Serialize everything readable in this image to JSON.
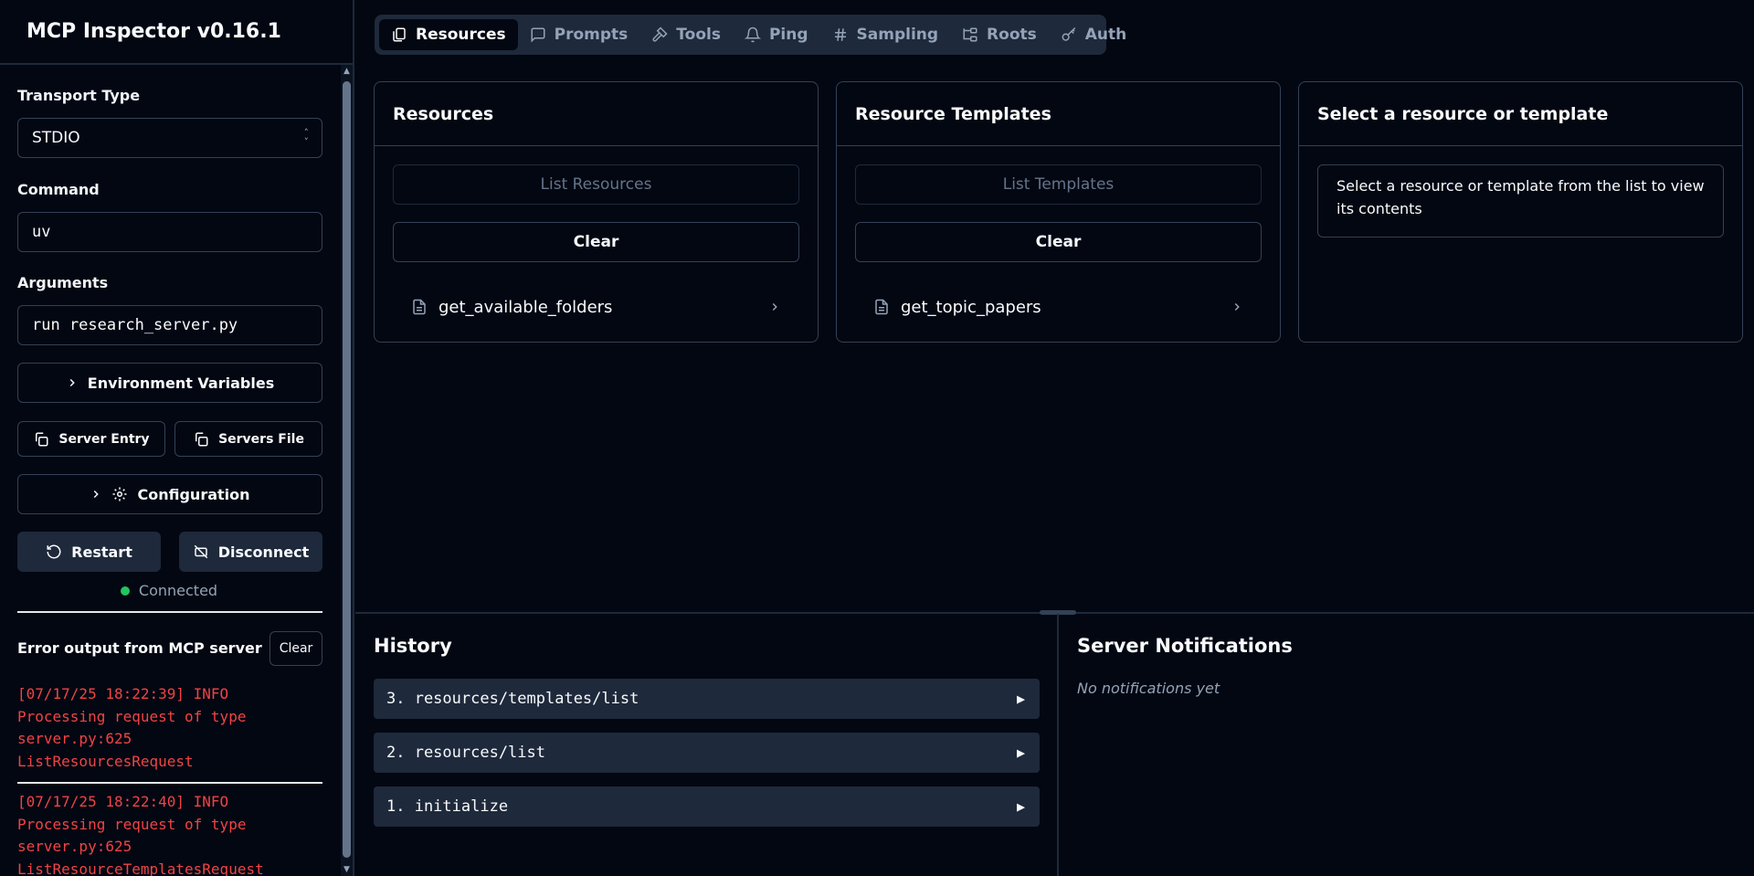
{
  "app": {
    "title": "MCP Inspector v0.16.1"
  },
  "sidebar": {
    "transport_label": "Transport Type",
    "transport_value": "STDIO",
    "command_label": "Command",
    "command_value": "uv",
    "arguments_label": "Arguments",
    "arguments_value": "run research_server.py",
    "env_vars_label": "Environment Variables",
    "server_entry_label": "Server Entry",
    "servers_file_label": "Servers File",
    "configuration_label": "Configuration",
    "restart_label": "Restart",
    "disconnect_label": "Disconnect",
    "status_text": "Connected",
    "status_color": "#22c55e",
    "error_title": "Error output from MCP server",
    "error_clear_label": "Clear",
    "error_entries": [
      "[07/17/25 18:22:39] INFO\nProcessing request of type\nserver.py:625\nListResourcesRequest",
      "[07/17/25 18:22:40] INFO\nProcessing request of type\nserver.py:625\nListResourceTemplatesRequest"
    ]
  },
  "tabs": [
    {
      "label": "Resources",
      "icon": "files-icon",
      "active": true
    },
    {
      "label": "Prompts",
      "icon": "message-square-icon",
      "active": false
    },
    {
      "label": "Tools",
      "icon": "hammer-icon",
      "active": false
    },
    {
      "label": "Ping",
      "icon": "bell-icon",
      "active": false
    },
    {
      "label": "Sampling",
      "icon": "hash-icon",
      "active": false
    },
    {
      "label": "Roots",
      "icon": "folder-tree-icon",
      "active": false
    },
    {
      "label": "Auth",
      "icon": "key-icon",
      "active": false
    }
  ],
  "resources": {
    "title": "Resources",
    "list_button": "List Resources",
    "clear_button": "Clear",
    "items": [
      "get_available_folders"
    ]
  },
  "templates": {
    "title": "Resource Templates",
    "list_button": "List Templates",
    "clear_button": "Clear",
    "items": [
      "get_topic_papers"
    ]
  },
  "detail": {
    "title": "Select a resource or template",
    "message": "Select a resource or template from the list to view its contents"
  },
  "history": {
    "title": "History",
    "items": [
      "3. resources/templates/list",
      "2. resources/list",
      "1. initialize"
    ]
  },
  "notifications": {
    "title": "Server Notifications",
    "empty_text": "No notifications yet"
  }
}
